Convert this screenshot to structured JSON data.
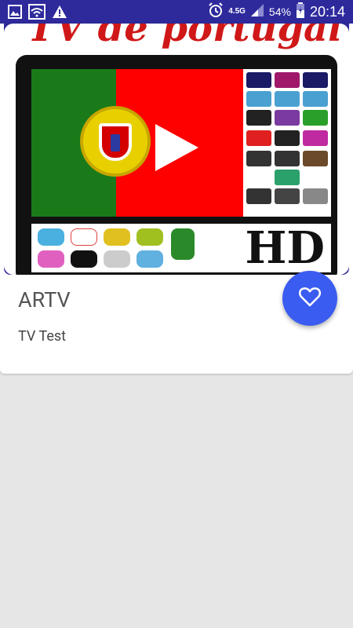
{
  "status_bar": {
    "icons": [
      "image-icon",
      "wifi-icon",
      "warning-icon",
      "alarm-icon",
      "signal-icon",
      "battery-icon"
    ],
    "network_top": "4.5G",
    "battery_percent": "54%",
    "time": "20:14"
  },
  "card": {
    "thumbnail_text": "TV de portugal",
    "title": "ARTV",
    "subtitle": "TV Test",
    "fab_icon": "heart-icon"
  },
  "colors": {
    "status_bar": "#2e2a9c",
    "fab": "#3b5cf0",
    "background": "#e6e6e6"
  }
}
